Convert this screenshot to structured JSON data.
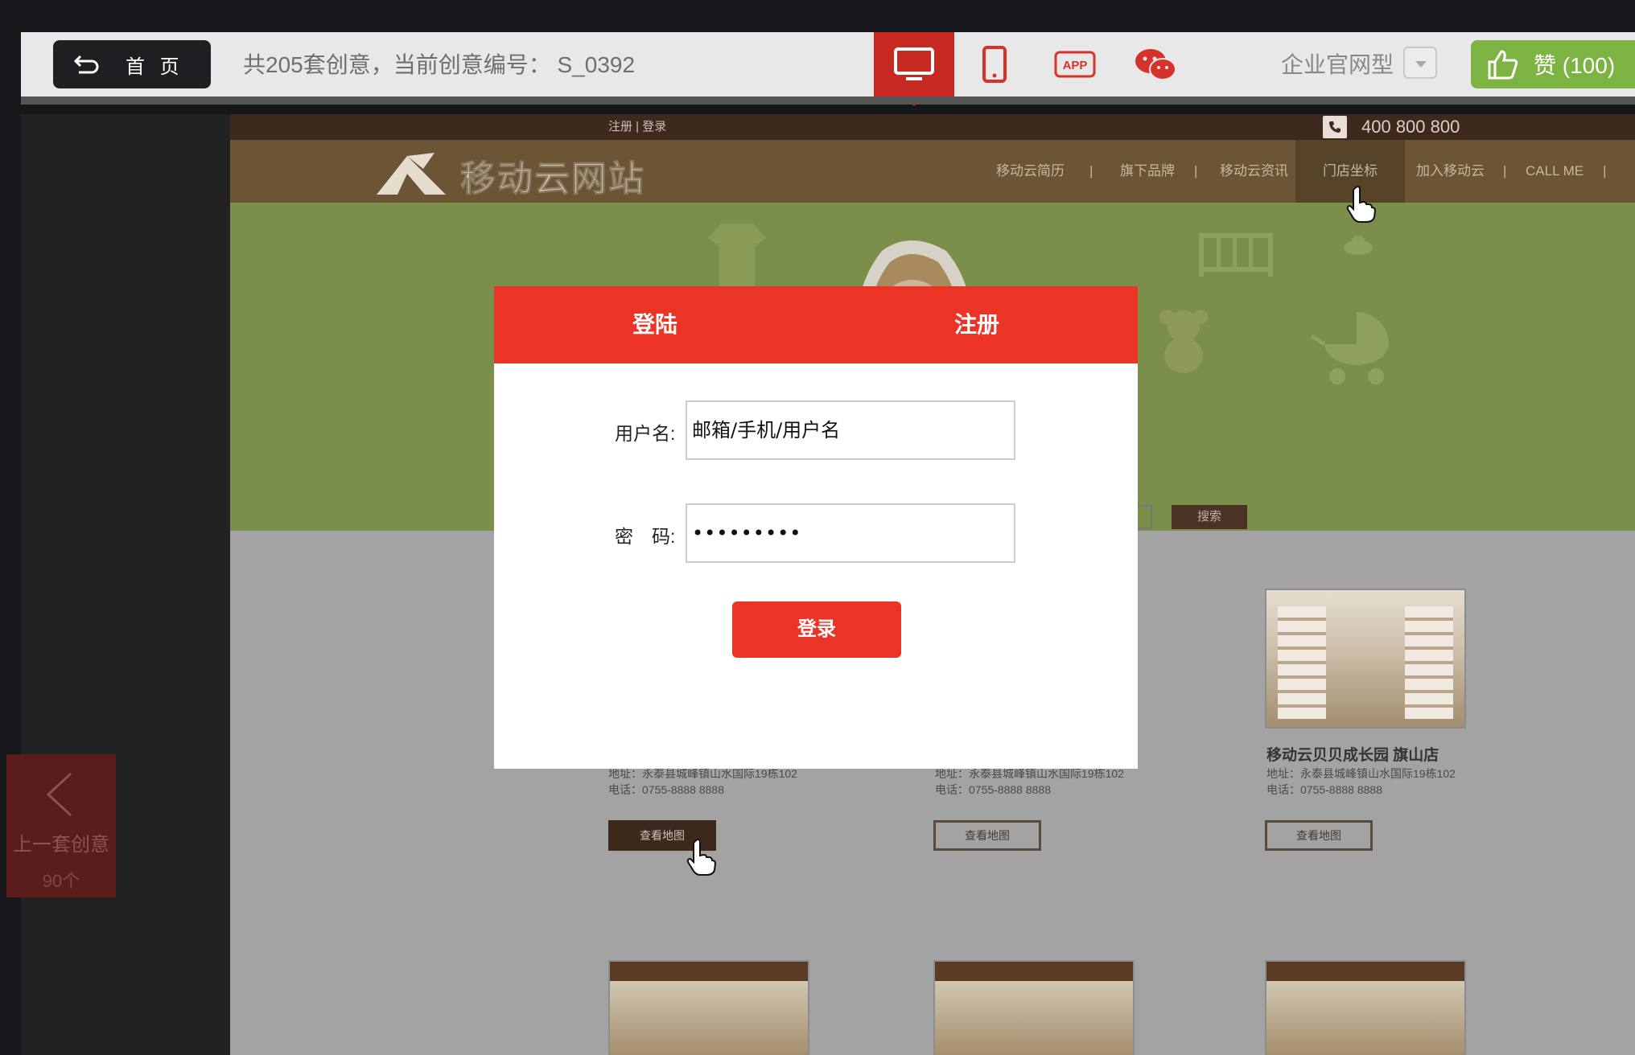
{
  "toolbar": {
    "home_label": "首 页",
    "count_text": "共205套创意，当前创意编号： S_0392",
    "device_icons": [
      "desktop-icon",
      "mobile-icon",
      "app-icon",
      "wechat-icon"
    ],
    "app_badge": "APP",
    "type_label": "企业官网型",
    "like_label": "赞 (100)"
  },
  "prev_creative": {
    "label": "上一套创意",
    "count": "90个"
  },
  "site": {
    "reg_login": "注册 | 登录",
    "phone": "400 800 800",
    "logo_text": "移动云网站",
    "nav": [
      "移动云简历",
      "|",
      "旗下品牌",
      "|",
      "移动云资讯",
      "门店坐标",
      "加入移动云",
      "|",
      "CALL ME",
      "|"
    ],
    "search_label": "搜索",
    "stores": [
      {
        "info1": "地址：永泰县城峰镇山水国际19栋102",
        "info2": "电话：0755-8888 8888",
        "button": "查看地图"
      },
      {
        "info1": "地址：永泰县城峰镇山水国际19栋102",
        "info2": "电话：0755-8888 8888",
        "button": "查看地图"
      },
      {
        "name": "移动云贝贝成长园 旗山店",
        "info1": "地址：永泰县城峰镇山水国际19栋102",
        "info2": "电话：0755-8888 8888",
        "button": "查看地图"
      }
    ]
  },
  "modal": {
    "tab_login": "登陆",
    "tab_register": "注册",
    "username_label": "用户名:",
    "username_value": "邮箱/手机/用户名",
    "password_label": "密　码:",
    "password_value": "•••••••••",
    "submit_label": "登录"
  },
  "colors": {
    "accent_red": "#e93426",
    "like_green": "#7cb342",
    "toolbar_bg": "#e8e8e8"
  }
}
